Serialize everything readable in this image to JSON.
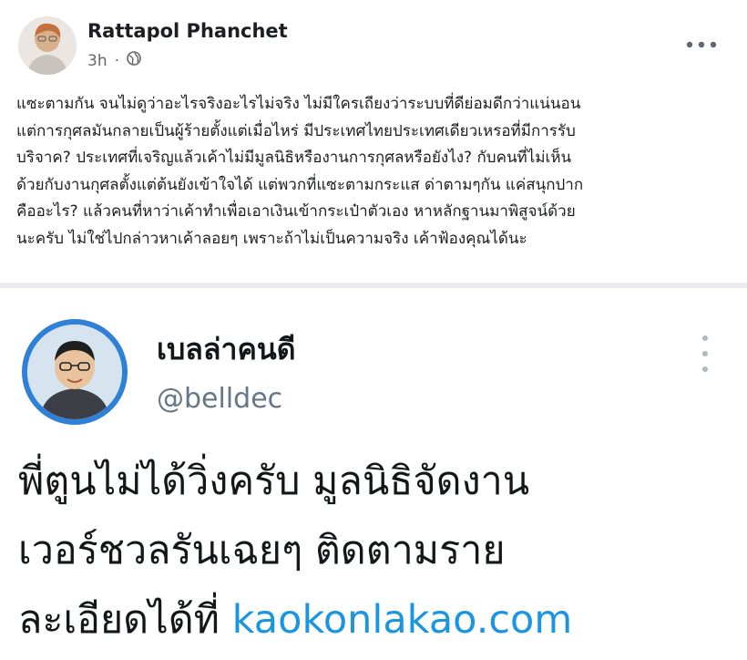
{
  "post": {
    "author": "Rattapol Phanchet",
    "time": "3h",
    "privacy_icon": "globe-icon",
    "menu_icon": "more-horizontal-icon",
    "lines": [
      "แซะตามกัน จนไม่ดูว่าอะไรจริงอะไรไม่จริง ไม่มีใครเถียงว่าระบบที่ดีย่อมดีกว่าแน่นอน",
      "แต่การกุศลมันกลายเป็นผู้ร้ายตั้งแต่เมื่อไหร่ มีประเทศไทยประเทศเดียวเหรอที่มีการรับ",
      "บริจาค? ประเทศที่เจริญแล้วเค้าไม่มีมูลนิธิหรืองานการกุศลหรือยังไง? กับคนที่ไม่เห็น",
      "ด้วยกับงานกุศลตั้งแต่ต้นยังเข้าใจได้ แต่พวกที่แซะตามกระแส ด่าตามๆกัน แค่สนุกปาก",
      "คืออะไร? แล้วคนที่หาว่าเค้าทำเพื่อเอาเงินเข้ากระเป๋าตัวเอง หาหลักฐานมาพิสูจน์ด้วย",
      "นะครับ ไม่ใช่ไปกล่าวหาเค้าลอยๆ เพราะถ้าไม่เป็นความจริง เค้าฟ้องคุณได้นะ"
    ]
  },
  "tweet": {
    "display_name": "เบลล่าคนดี",
    "handle": "@belldec",
    "menu_icon": "more-vertical-icon",
    "lines": [
      "พี่ตูนไม่ได้วิ่งครับ มูลนิธิจัดงาน",
      "เวอร์ชวลรันเฉยๆ ติดตามราย"
    ],
    "last_line_prefix": "ละเอียดได้ที่ ",
    "link": "kaokonlakao.com",
    "link_color": "#1b95e0"
  }
}
